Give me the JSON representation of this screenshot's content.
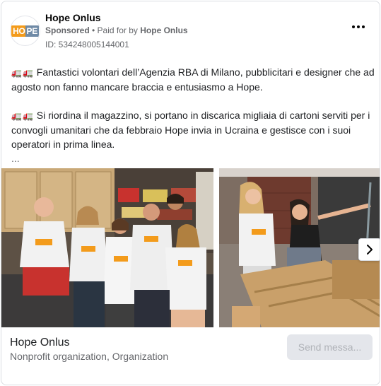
{
  "header": {
    "page_name": "Hope Onlus",
    "sponsored": "Sponsored",
    "separator": " • ",
    "paid_prefix": "Paid for by ",
    "paid_by": "Hope Onlus",
    "ad_id": "ID: 534248005144001",
    "logo_left": "HO",
    "logo_right": "PE"
  },
  "post": {
    "emoji_1": "🚛🚛",
    "paragraph_1": "Fantastici volontari dell’Agenzia RBA di Milano, pubblicitari e designer che ad agosto non fanno mancare braccia e entusiasmo a Hope.",
    "emoji_2": "🚛🚛",
    "paragraph_2": "Si riordina il magazzino, si portano in discarica migliaia di cartoni serviti per i convogli umanitari che da febbraio Hope invia in Ucraina e gestisce con i suoi operatori in prima linea.",
    "see_more": "..."
  },
  "carousel": {
    "slides": [
      {
        "name": "volunteers-group-photo",
        "tshirt_text": "HOPE"
      },
      {
        "name": "volunteers-sorting-boxes-photo",
        "tshirt_text": "HOPE"
      }
    ]
  },
  "footer": {
    "title": "Hope Onlus",
    "subtitle": "Nonprofit organization, Organization",
    "cta": "Send messa..."
  },
  "colors": {
    "brand_orange": "#f39b1b",
    "brand_blue": "#6f8aa6",
    "cta_bg": "#e4e6eb",
    "secondary_text": "#65676b"
  }
}
